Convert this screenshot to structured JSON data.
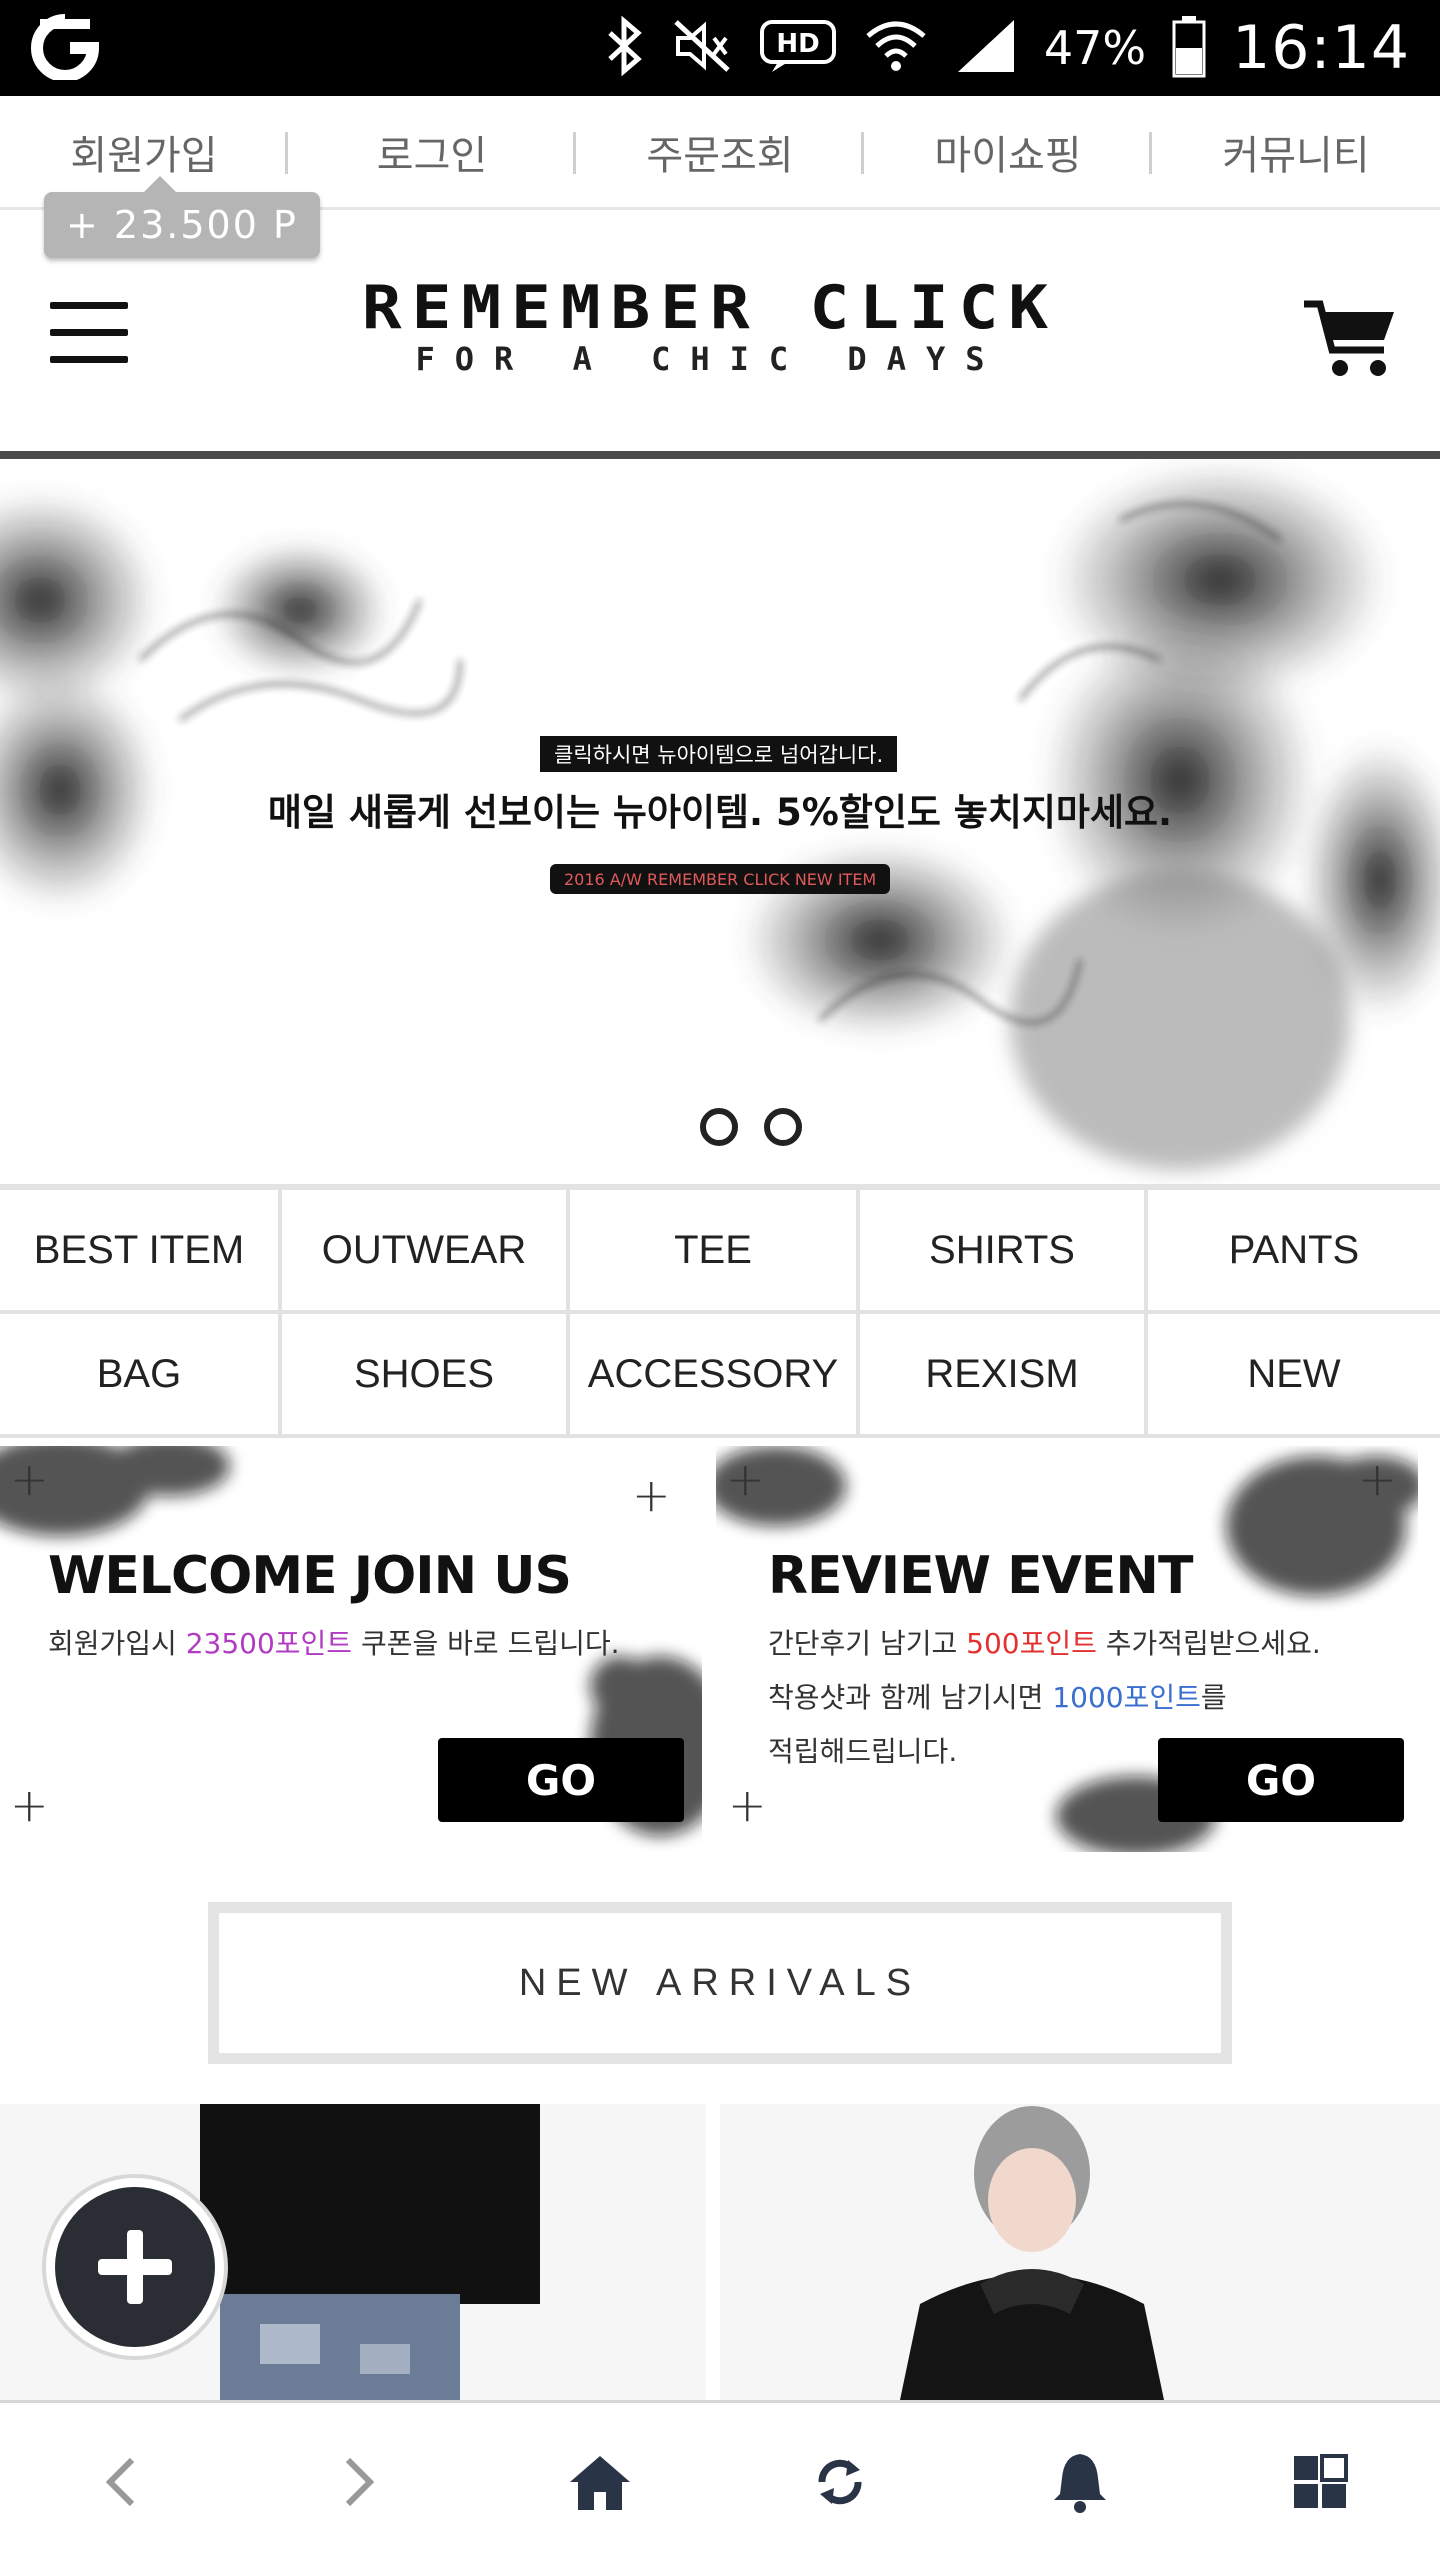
{
  "status_bar": {
    "icons": [
      "app-logo-icon",
      "bluetooth-icon",
      "mute-icon",
      "hd-voice-icon",
      "wifi-icon",
      "signal-icon",
      "battery-icon"
    ],
    "hd_label": "HD",
    "battery_percent": "47%",
    "time": "16:14"
  },
  "top_nav": {
    "items": [
      {
        "label": "회원가입"
      },
      {
        "label": "로그인"
      },
      {
        "label": "주문조회"
      },
      {
        "label": "마이쇼핑"
      },
      {
        "label": "커뮤니티"
      }
    ],
    "points_badge": "+ 23.500 P"
  },
  "header": {
    "logo_main": "REMEMBER CLICK",
    "logo_sub": "FOR A CHIC DAYS",
    "menu_icon": "hamburger-icon",
    "cart_icon": "cart-icon"
  },
  "banner": {
    "small_caption": "클릭하시면 뉴아이템으로 넘어갑니다.",
    "headline": "매일 새롭게 선보이는 뉴아이템. 5%할인도 놓치지마세요.",
    "tag": "2016 A/W REMEMBER CLICK NEW ITEM",
    "slide_count": 2
  },
  "categories": [
    {
      "label": "BEST ITEM"
    },
    {
      "label": "OUTWEAR"
    },
    {
      "label": "TEE"
    },
    {
      "label": "SHIRTS"
    },
    {
      "label": "PANTS"
    },
    {
      "label": "BAG"
    },
    {
      "label": "SHOES"
    },
    {
      "label": "ACCESSORY"
    },
    {
      "label": "REXISM"
    },
    {
      "label": "NEW"
    }
  ],
  "promos": {
    "welcome": {
      "title": "WELCOME JOIN US",
      "line1_pre": "회원가입시 ",
      "line1_highlight": "23500포인트",
      "line1_post": " 쿠폰을 바로 드립니다.",
      "button": "GO"
    },
    "review": {
      "title": "REVIEW EVENT",
      "line1_pre": "간단후기 남기고 ",
      "line1_highlight": "500포인트",
      "line1_post": " 추가적립받으세요.",
      "line2_pre": "착용샷과 함께 남기시면 ",
      "line2_highlight": "1000포인트",
      "line2_post": "를",
      "line3": "적립해드립니다.",
      "button": "GO"
    },
    "colors": {
      "purple": "#b23bc4",
      "red": "#e2312f",
      "blue": "#3a6fd0"
    }
  },
  "new_arrivals": {
    "label": "NEW ARRIVALS"
  },
  "fab_icon": "plus-icon",
  "bottom_bar": {
    "items": [
      "back-icon",
      "forward-icon",
      "home-icon",
      "refresh-icon",
      "bell-icon",
      "tabs-icon"
    ]
  }
}
